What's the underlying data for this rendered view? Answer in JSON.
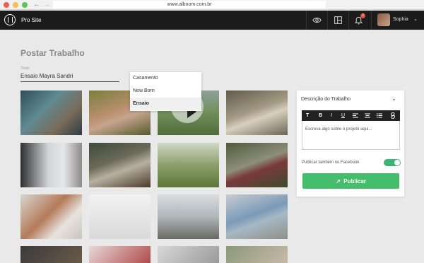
{
  "browser": {
    "url": "www.alboom.com.br"
  },
  "header": {
    "site_name": "Pro Site",
    "notification_count": "2",
    "user_name": "Sophia",
    "icons": [
      "eye-icon",
      "layout-icon",
      "bell-icon"
    ]
  },
  "page": {
    "title": "Postar Trabalho",
    "title_field_label": "Título",
    "title_field_value": "Ensaio Mayra Sandri"
  },
  "dropdown": {
    "options": [
      "Casamento",
      "New Born",
      "Ensaio"
    ],
    "selected": "Ensaio"
  },
  "panel": {
    "heading": "Descrição do Trabalho",
    "toolbar_buttons": [
      "T",
      "B",
      "I",
      "U",
      "align-left-icon",
      "align-center-icon",
      "list-icon",
      "link-icon"
    ],
    "editor_placeholder": "Escreva algo sobre o projeto aqui...",
    "facebook_label": "Publicar também no Facebook",
    "facebook_toggle_on": true,
    "publish_label": "Publicar"
  },
  "colors": {
    "header_bg": "#1b1b1b",
    "accent_green": "#44be6c",
    "toggle_green": "#3cb371",
    "badge_red": "#e74c3c"
  }
}
